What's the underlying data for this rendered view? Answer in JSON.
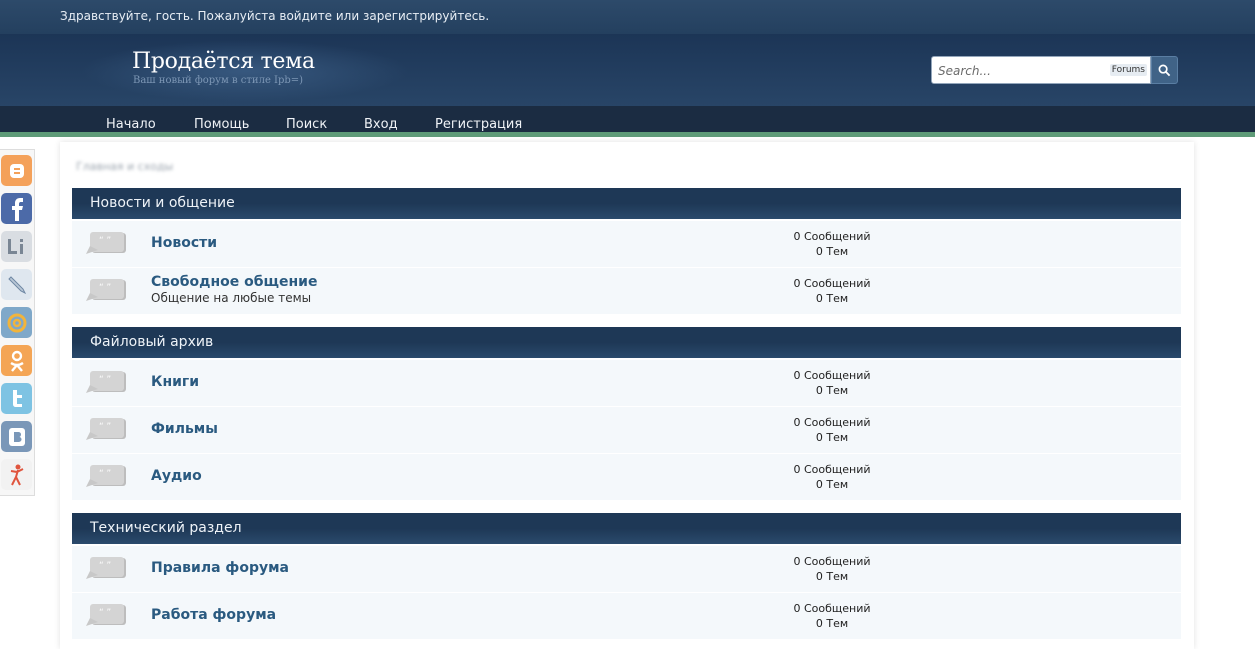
{
  "topbar": {
    "greeting": "Здравствуйте, гость. Пожалуйста войдите или зарегистрируйтесь."
  },
  "header": {
    "title": "Продаётся тема",
    "subtitle": "Ваш новый форум в стиле Ipb=)",
    "search_placeholder": "Search...",
    "search_scope": "Forums"
  },
  "nav": [
    "Начало",
    "Помощь",
    "Поиск",
    "Вход",
    "Регистрация"
  ],
  "breadcrumb": "Главная и сходы",
  "share_icons": [
    "blogger-icon",
    "facebook-icon",
    "linkedin-icon",
    "livejournal-icon",
    "mailru-icon",
    "odnoklassniki-icon",
    "twitter-icon",
    "vkontakte-icon",
    "yaru-icon"
  ],
  "categories": [
    {
      "name": "Новости и общение",
      "forums": [
        {
          "title": "Новости",
          "description": "",
          "posts": "0 Сообщений",
          "topics": "0 Тем"
        },
        {
          "title": "Свободное общение",
          "description": "Общение на любые темы",
          "posts": "0 Сообщений",
          "topics": "0 Тем"
        }
      ]
    },
    {
      "name": "Файловый архив",
      "forums": [
        {
          "title": "Книги",
          "description": "",
          "posts": "0 Сообщений",
          "topics": "0 Тем"
        },
        {
          "title": "Фильмы",
          "description": "",
          "posts": "0 Сообщений",
          "topics": "0 Тем"
        },
        {
          "title": "Аудио",
          "description": "",
          "posts": "0 Сообщений",
          "topics": "0 Тем"
        }
      ]
    },
    {
      "name": "Технический раздел",
      "forums": [
        {
          "title": "Правила форума",
          "description": "",
          "posts": "0 Сообщений",
          "topics": "0 Тем"
        },
        {
          "title": "Работа форума",
          "description": "",
          "posts": "0 Сообщений",
          "topics": "0 Тем"
        }
      ]
    }
  ],
  "colors": {
    "header_bg": "#1c3556",
    "nav_accent": "#5e9b78",
    "link": "#2a5a80"
  }
}
